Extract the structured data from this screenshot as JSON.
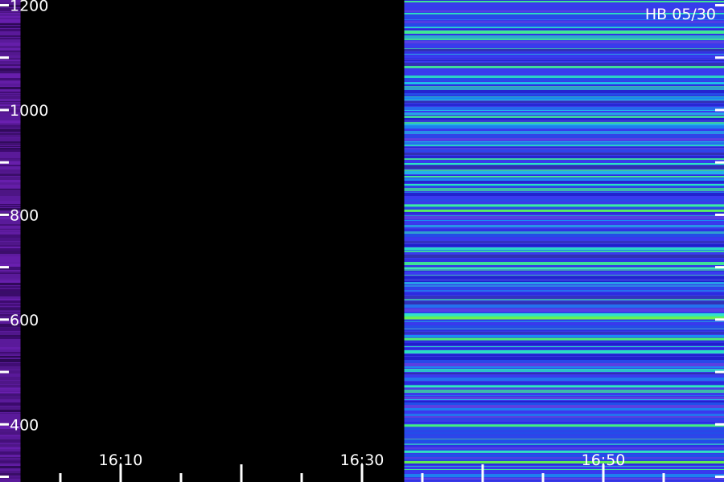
{
  "chart_data": {
    "type": "heatmap",
    "title": "HB 05/30",
    "xlabel": "",
    "ylabel": "",
    "x_ticks": [
      "16:10",
      "16:30",
      "16:50"
    ],
    "x_tick_minutes": [
      10,
      30,
      50
    ],
    "x_range_minutes": [
      0,
      60
    ],
    "x_minor_step_minutes": 5,
    "y_ticks": [
      400,
      600,
      800,
      1000,
      1200
    ],
    "y_range": [
      290,
      1210
    ],
    "y_minor_step": 100,
    "grid": false,
    "legend": "none",
    "segments": [
      {
        "name": "",
        "start_minute": 0,
        "end_minute": 1.7,
        "level": "low",
        "color": "#5a1a9a"
      },
      {
        "name": "",
        "start_minute": 1.7,
        "end_minute": 33.5,
        "level": "none",
        "color": "#000000"
      },
      {
        "name": "",
        "start_minute": 33.5,
        "end_minute": 60,
        "level": "high",
        "color": "#3a3ae8"
      }
    ],
    "colorscale": [
      "#000000",
      "#2a0a5a",
      "#5a1a9a",
      "#3a3ae8",
      "#2aa0f0",
      "#2af0c8",
      "#7af03a"
    ]
  }
}
